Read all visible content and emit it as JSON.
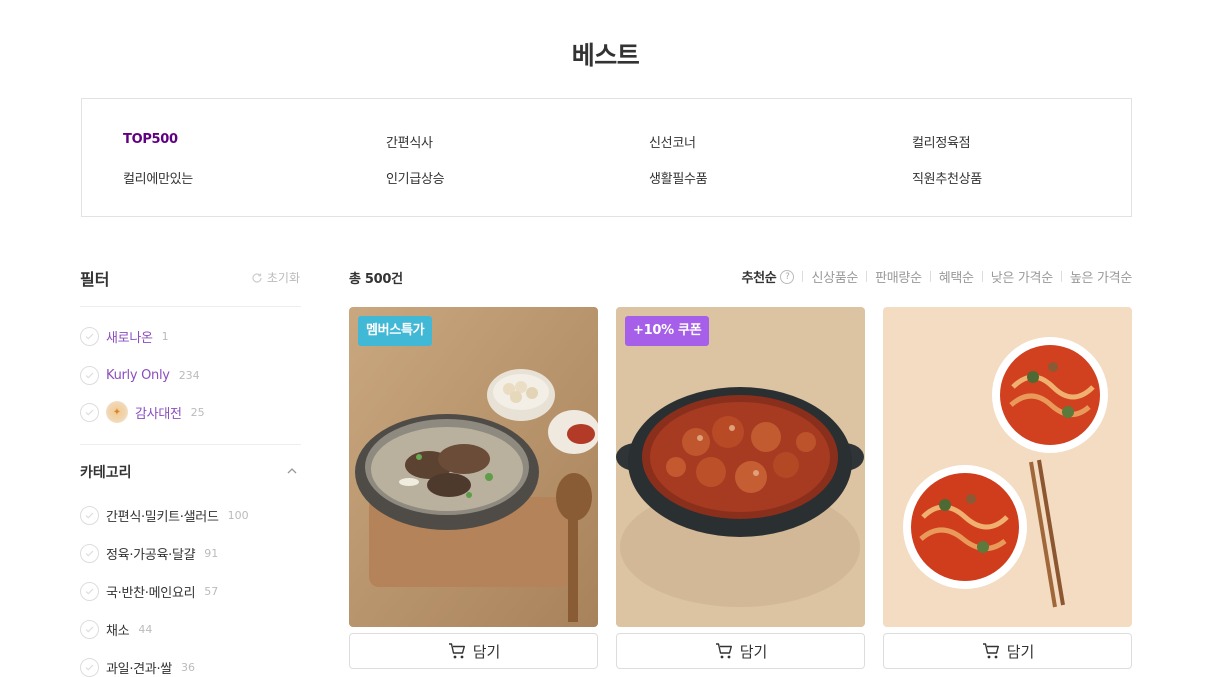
{
  "page": {
    "title": "베스트"
  },
  "categories": {
    "items": [
      {
        "label": "TOP500",
        "active": true
      },
      {
        "label": "간편식사",
        "active": false
      },
      {
        "label": "신선코너",
        "active": false
      },
      {
        "label": "컬리정육점",
        "active": false
      },
      {
        "label": "컬리에만있는",
        "active": false
      },
      {
        "label": "인기급상승",
        "active": false
      },
      {
        "label": "생활필수품",
        "active": false
      },
      {
        "label": "직원추천상품",
        "active": false
      }
    ]
  },
  "filter": {
    "title": "필터",
    "reset_label": "초기화",
    "quick": [
      {
        "label": "새로나온",
        "count": "1"
      },
      {
        "label": "Kurly Only",
        "count": "234"
      },
      {
        "label": "감사대전",
        "count": "25"
      }
    ],
    "category_title": "카테고리",
    "category_items": [
      {
        "label": "간편식·밀키트·샐러드",
        "count": "100"
      },
      {
        "label": "정육·가공육·달걀",
        "count": "91"
      },
      {
        "label": "국·반찬·메인요리",
        "count": "57"
      },
      {
        "label": "채소",
        "count": "44"
      },
      {
        "label": "과일·견과·쌀",
        "count": "36"
      }
    ]
  },
  "list": {
    "total_label": "총 500건",
    "sort_options": [
      "추천순",
      "신상품순",
      "판매량순",
      "혜택순",
      "낮은 가격순",
      "높은 가격순"
    ],
    "active_sort": "추천순",
    "cart_label": "담기"
  },
  "products": [
    {
      "badge": "멤버스특가",
      "badge_color": "#41b8d5",
      "image": "bowl-of-galbitang-soup"
    },
    {
      "badge": "+10% 쿠폰",
      "badge_color": "#a55fe8",
      "image": "spicy-stir-fried-octopus"
    },
    {
      "badge": "",
      "badge_color": "",
      "image": "two-bowls-of-spicy-noodle-soup"
    }
  ],
  "colors": {
    "accent": "#5f0080",
    "purple_text": "#8b4ec0"
  }
}
